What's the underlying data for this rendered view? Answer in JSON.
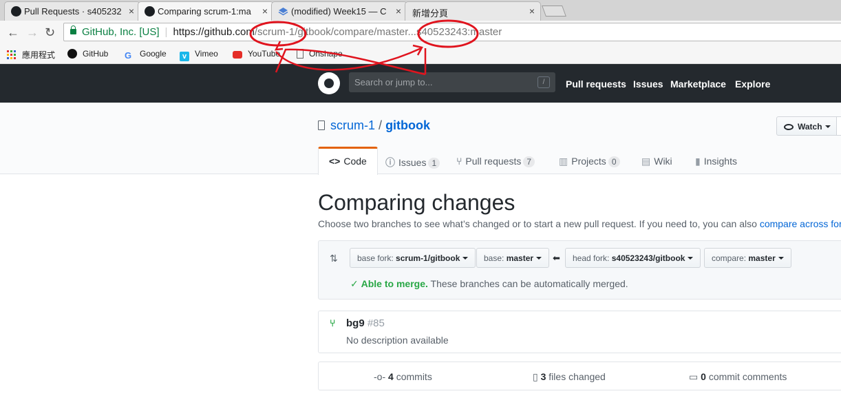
{
  "browser": {
    "tabs": [
      {
        "title": "Pull Requests · s405232",
        "close": "×"
      },
      {
        "title": "Comparing scrum-1:ma",
        "close": "×"
      },
      {
        "title": "(modified) Week15 — C",
        "close": "×"
      },
      {
        "title": "新增分頁",
        "close": "×"
      }
    ],
    "security_label": "GitHub, Inc. [US]",
    "url_scheme_host": "https://github.com",
    "url_path": "/scrum-1/gitbook/compare/master...s40523243:master",
    "bookmarks": [
      {
        "label": "應用程式",
        "icon": "apps-grid-icon"
      },
      {
        "label": "GitHub",
        "icon": "github-icon"
      },
      {
        "label": "Google",
        "icon": "google-icon"
      },
      {
        "label": "Vimeo",
        "icon": "vimeo-icon"
      },
      {
        "label": "YouTube",
        "icon": "youtube-icon"
      },
      {
        "label": "Onshape",
        "icon": "page-icon"
      }
    ]
  },
  "github": {
    "search_placeholder": "Search or jump to...",
    "search_key": "/",
    "nav": [
      "Pull requests",
      "Issues",
      "Marketplace",
      "Explore"
    ]
  },
  "repo": {
    "owner": "scrum-1",
    "separator": "/",
    "name": "gitbook",
    "watch_label": "Watch",
    "tabs": [
      {
        "label": "Code",
        "icon": "code-icon"
      },
      {
        "label": "Issues",
        "icon": "issue-icon",
        "count": "1"
      },
      {
        "label": "Pull requests",
        "icon": "pull-request-icon",
        "count": "7"
      },
      {
        "label": "Projects",
        "icon": "project-icon",
        "count": "0"
      },
      {
        "label": "Wiki",
        "icon": "book-icon"
      },
      {
        "label": "Insights",
        "icon": "graph-icon"
      }
    ]
  },
  "compare": {
    "heading": "Comparing changes",
    "lead": "Choose two branches to see what’s changed or to start a new pull request. If you need to, you can also",
    "lead_link": "compare across forks",
    "base_fork_label": "base fork:",
    "base_fork_value": "scrum-1/gitbook",
    "base_label": "base:",
    "base_value": "master",
    "head_fork_label": "head fork:",
    "head_fork_value": "s40523243/gitbook",
    "compare_label": "compare:",
    "compare_value": "master",
    "merge_ok": "Able to merge.",
    "merge_text": "These branches can be automatically merged."
  },
  "pull_request": {
    "title": "bg9",
    "number": "#85",
    "description": "No description available"
  },
  "summary": {
    "commits_count": "4",
    "commits_label": "commits",
    "files_count": "3",
    "files_label": "files changed",
    "comments_count": "0",
    "comments_label": "commit comments"
  },
  "colors": {
    "annotation": "#e0141e",
    "accent": "#0366d6",
    "success": "#28a745"
  }
}
